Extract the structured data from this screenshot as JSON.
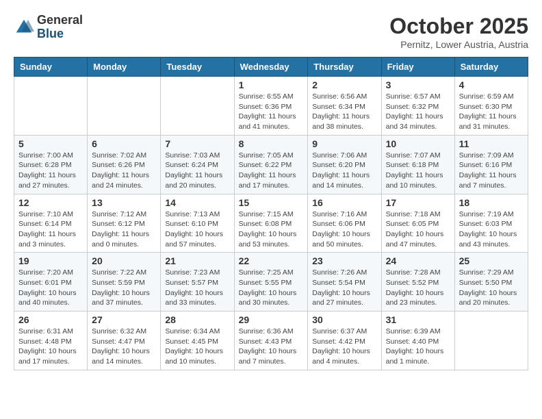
{
  "header": {
    "logo_general": "General",
    "logo_blue": "Blue",
    "month": "October 2025",
    "location": "Pernitz, Lower Austria, Austria"
  },
  "weekdays": [
    "Sunday",
    "Monday",
    "Tuesday",
    "Wednesday",
    "Thursday",
    "Friday",
    "Saturday"
  ],
  "weeks": [
    [
      {
        "day": "",
        "info": ""
      },
      {
        "day": "",
        "info": ""
      },
      {
        "day": "",
        "info": ""
      },
      {
        "day": "1",
        "info": "Sunrise: 6:55 AM\nSunset: 6:36 PM\nDaylight: 11 hours\nand 41 minutes."
      },
      {
        "day": "2",
        "info": "Sunrise: 6:56 AM\nSunset: 6:34 PM\nDaylight: 11 hours\nand 38 minutes."
      },
      {
        "day": "3",
        "info": "Sunrise: 6:57 AM\nSunset: 6:32 PM\nDaylight: 11 hours\nand 34 minutes."
      },
      {
        "day": "4",
        "info": "Sunrise: 6:59 AM\nSunset: 6:30 PM\nDaylight: 11 hours\nand 31 minutes."
      }
    ],
    [
      {
        "day": "5",
        "info": "Sunrise: 7:00 AM\nSunset: 6:28 PM\nDaylight: 11 hours\nand 27 minutes."
      },
      {
        "day": "6",
        "info": "Sunrise: 7:02 AM\nSunset: 6:26 PM\nDaylight: 11 hours\nand 24 minutes."
      },
      {
        "day": "7",
        "info": "Sunrise: 7:03 AM\nSunset: 6:24 PM\nDaylight: 11 hours\nand 20 minutes."
      },
      {
        "day": "8",
        "info": "Sunrise: 7:05 AM\nSunset: 6:22 PM\nDaylight: 11 hours\nand 17 minutes."
      },
      {
        "day": "9",
        "info": "Sunrise: 7:06 AM\nSunset: 6:20 PM\nDaylight: 11 hours\nand 14 minutes."
      },
      {
        "day": "10",
        "info": "Sunrise: 7:07 AM\nSunset: 6:18 PM\nDaylight: 11 hours\nand 10 minutes."
      },
      {
        "day": "11",
        "info": "Sunrise: 7:09 AM\nSunset: 6:16 PM\nDaylight: 11 hours\nand 7 minutes."
      }
    ],
    [
      {
        "day": "12",
        "info": "Sunrise: 7:10 AM\nSunset: 6:14 PM\nDaylight: 11 hours\nand 3 minutes."
      },
      {
        "day": "13",
        "info": "Sunrise: 7:12 AM\nSunset: 6:12 PM\nDaylight: 11 hours\nand 0 minutes."
      },
      {
        "day": "14",
        "info": "Sunrise: 7:13 AM\nSunset: 6:10 PM\nDaylight: 10 hours\nand 57 minutes."
      },
      {
        "day": "15",
        "info": "Sunrise: 7:15 AM\nSunset: 6:08 PM\nDaylight: 10 hours\nand 53 minutes."
      },
      {
        "day": "16",
        "info": "Sunrise: 7:16 AM\nSunset: 6:06 PM\nDaylight: 10 hours\nand 50 minutes."
      },
      {
        "day": "17",
        "info": "Sunrise: 7:18 AM\nSunset: 6:05 PM\nDaylight: 10 hours\nand 47 minutes."
      },
      {
        "day": "18",
        "info": "Sunrise: 7:19 AM\nSunset: 6:03 PM\nDaylight: 10 hours\nand 43 minutes."
      }
    ],
    [
      {
        "day": "19",
        "info": "Sunrise: 7:20 AM\nSunset: 6:01 PM\nDaylight: 10 hours\nand 40 minutes."
      },
      {
        "day": "20",
        "info": "Sunrise: 7:22 AM\nSunset: 5:59 PM\nDaylight: 10 hours\nand 37 minutes."
      },
      {
        "day": "21",
        "info": "Sunrise: 7:23 AM\nSunset: 5:57 PM\nDaylight: 10 hours\nand 33 minutes."
      },
      {
        "day": "22",
        "info": "Sunrise: 7:25 AM\nSunset: 5:55 PM\nDaylight: 10 hours\nand 30 minutes."
      },
      {
        "day": "23",
        "info": "Sunrise: 7:26 AM\nSunset: 5:54 PM\nDaylight: 10 hours\nand 27 minutes."
      },
      {
        "day": "24",
        "info": "Sunrise: 7:28 AM\nSunset: 5:52 PM\nDaylight: 10 hours\nand 23 minutes."
      },
      {
        "day": "25",
        "info": "Sunrise: 7:29 AM\nSunset: 5:50 PM\nDaylight: 10 hours\nand 20 minutes."
      }
    ],
    [
      {
        "day": "26",
        "info": "Sunrise: 6:31 AM\nSunset: 4:48 PM\nDaylight: 10 hours\nand 17 minutes."
      },
      {
        "day": "27",
        "info": "Sunrise: 6:32 AM\nSunset: 4:47 PM\nDaylight: 10 hours\nand 14 minutes."
      },
      {
        "day": "28",
        "info": "Sunrise: 6:34 AM\nSunset: 4:45 PM\nDaylight: 10 hours\nand 10 minutes."
      },
      {
        "day": "29",
        "info": "Sunrise: 6:36 AM\nSunset: 4:43 PM\nDaylight: 10 hours\nand 7 minutes."
      },
      {
        "day": "30",
        "info": "Sunrise: 6:37 AM\nSunset: 4:42 PM\nDaylight: 10 hours\nand 4 minutes."
      },
      {
        "day": "31",
        "info": "Sunrise: 6:39 AM\nSunset: 4:40 PM\nDaylight: 10 hours\nand 1 minute."
      },
      {
        "day": "",
        "info": ""
      }
    ]
  ]
}
